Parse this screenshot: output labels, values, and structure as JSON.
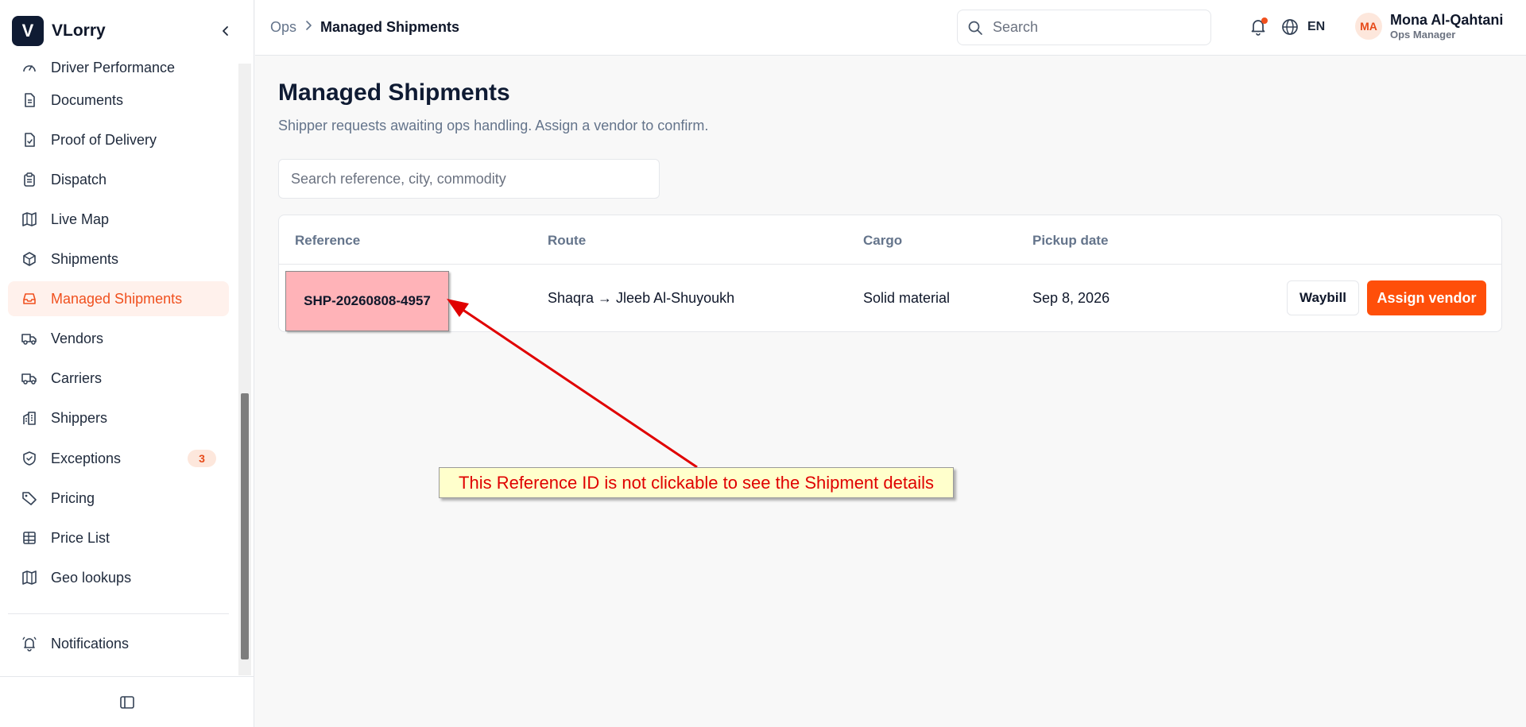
{
  "app": {
    "logo_letter": "V",
    "name": "VLorry"
  },
  "sidebar": {
    "items": [
      {
        "label": "Driver Performance",
        "icon": "gauge-icon"
      },
      {
        "label": "Documents",
        "icon": "document-icon"
      },
      {
        "label": "Proof of Delivery",
        "icon": "file-check-icon"
      },
      {
        "label": "Dispatch",
        "icon": "clipboard-icon"
      },
      {
        "label": "Live Map",
        "icon": "map-icon"
      },
      {
        "label": "Shipments",
        "icon": "package-icon"
      },
      {
        "label": "Managed Shipments",
        "icon": "inbox-icon",
        "active": true
      },
      {
        "label": "Vendors",
        "icon": "truck-icon"
      },
      {
        "label": "Carriers",
        "icon": "truck-icon"
      },
      {
        "label": "Shippers",
        "icon": "building-icon"
      },
      {
        "label": "Exceptions",
        "icon": "shield-icon",
        "badge": "3"
      },
      {
        "label": "Pricing",
        "icon": "tag-icon"
      },
      {
        "label": "Price List",
        "icon": "table-icon"
      },
      {
        "label": "Geo lookups",
        "icon": "map-icon"
      },
      {
        "label": "Notifications",
        "icon": "bell-ring-icon"
      }
    ]
  },
  "topbar": {
    "breadcrumb": {
      "root": "Ops",
      "current": "Managed Shipments"
    },
    "search_placeholder": "Search",
    "language": "EN",
    "user": {
      "initials": "MA",
      "name": "Mona Al-Qahtani",
      "role": "Ops Manager"
    }
  },
  "main": {
    "title": "Managed Shipments",
    "subtitle": "Shipper requests awaiting ops handling. Assign a vendor to confirm.",
    "filter_placeholder": "Search reference, city, commodity",
    "table": {
      "columns": [
        "Reference",
        "Route",
        "Cargo",
        "Pickup date"
      ],
      "rows": [
        {
          "reference": "SHP-20260808-4957",
          "route": "Shaqra → Jleeb Al-Shuyoukh",
          "cargo": "Solid material",
          "pickup_date": "Sep 8, 2026",
          "waybill_label": "Waybill",
          "assign_label": "Assign vendor"
        }
      ]
    }
  },
  "annotation": {
    "text": "This Reference ID is not clickable to see the Shipment details",
    "color": "#e00000"
  },
  "colors": {
    "accent": "#ff4f0a",
    "brand": "#0f1b33",
    "active_bg": "#fff1ec"
  }
}
